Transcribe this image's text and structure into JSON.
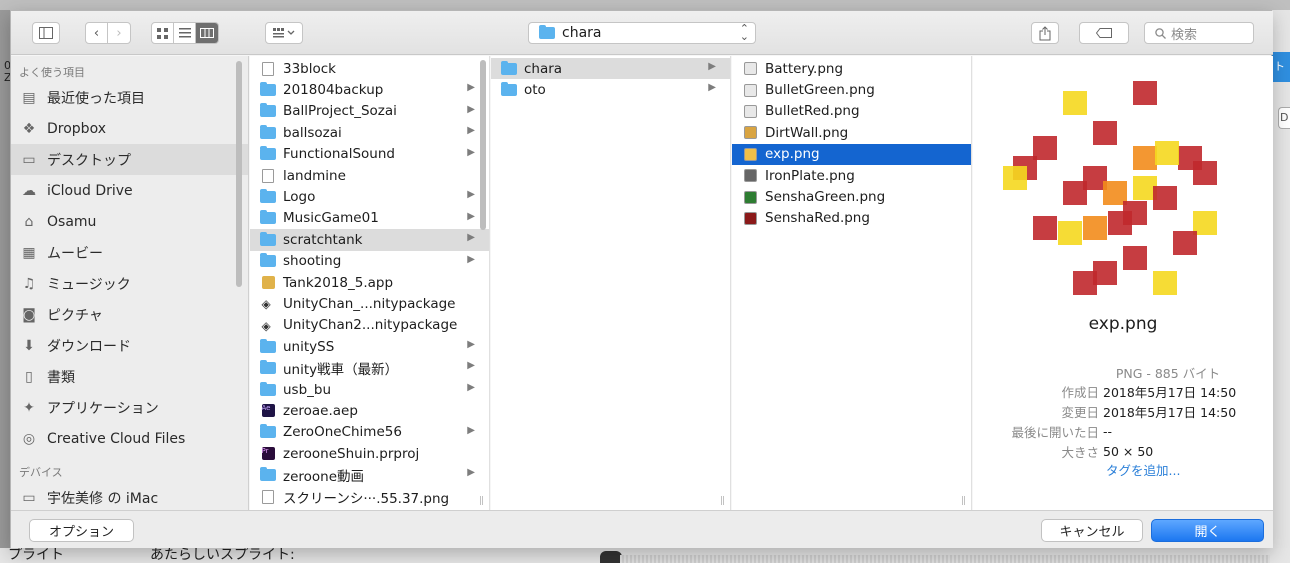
{
  "background": {
    "left_label": "0\nZ",
    "right_strip_label": "ト",
    "right_button_label": "D",
    "bottom_left_text": "プライト",
    "bottom_mid_text": "あたらしいスプライト: "
  },
  "toolbar": {
    "path_popup_label": "chara",
    "search_placeholder": "検索",
    "view_modes": [
      "icon",
      "list",
      "column"
    ],
    "active_view": "column"
  },
  "sidebar": {
    "favorites_heading": "よく使う項目",
    "items": [
      {
        "label": "最近使った項目",
        "icon": "recent-icon"
      },
      {
        "label": "Dropbox",
        "icon": "dropbox-icon"
      },
      {
        "label": "デスクトップ",
        "icon": "desktop-icon",
        "selected": true
      },
      {
        "label": "iCloud Drive",
        "icon": "cloud-icon"
      },
      {
        "label": "Osamu",
        "icon": "home-icon"
      },
      {
        "label": "ムービー",
        "icon": "movie-icon"
      },
      {
        "label": "ミュージック",
        "icon": "music-icon"
      },
      {
        "label": "ピクチャ",
        "icon": "camera-icon"
      },
      {
        "label": "ダウンロード",
        "icon": "download-icon"
      },
      {
        "label": "書類",
        "icon": "document-icon"
      },
      {
        "label": "アプリケーション",
        "icon": "applications-icon"
      },
      {
        "label": "Creative Cloud Files",
        "icon": "creative-cloud-icon"
      }
    ],
    "devices_heading": "デバイス",
    "devices": [
      {
        "label": "宇佐美修 の iMac",
        "icon": "imac-icon"
      }
    ]
  },
  "column1": {
    "items": [
      {
        "label": "33block",
        "type": "doc"
      },
      {
        "label": "201804backup",
        "type": "folder",
        "chevron": true
      },
      {
        "label": "BallProject_Sozai",
        "type": "folder",
        "chevron": true
      },
      {
        "label": "ballsozai",
        "type": "folder",
        "chevron": true
      },
      {
        "label": "FunctionalSound",
        "type": "folder",
        "chevron": true
      },
      {
        "label": "landmine",
        "type": "doc"
      },
      {
        "label": "Logo",
        "type": "folder",
        "chevron": true
      },
      {
        "label": "MusicGame01",
        "type": "folder",
        "chevron": true
      },
      {
        "label": "scratchtank",
        "type": "folder",
        "chevron": true,
        "state": "grey"
      },
      {
        "label": "shooting",
        "type": "folder",
        "chevron": true
      },
      {
        "label": "Tank2018_5.app",
        "type": "app"
      },
      {
        "label": "UnityChan_...nitypackage",
        "type": "unity"
      },
      {
        "label": "UnityChan2...nitypackage",
        "type": "unity"
      },
      {
        "label": "unitySS",
        "type": "folder",
        "chevron": true
      },
      {
        "label": "unity戦車（最新）",
        "type": "folder",
        "chevron": true
      },
      {
        "label": "usb_bu",
        "type": "folder",
        "chevron": true
      },
      {
        "label": "zeroae.aep",
        "type": "ae"
      },
      {
        "label": "ZeroOneChime56",
        "type": "folder",
        "chevron": true
      },
      {
        "label": "zerooneShuin.prproj",
        "type": "pr"
      },
      {
        "label": "zeroone動画",
        "type": "folder",
        "chevron": true
      },
      {
        "label": "スクリーンシ···.55.37.png",
        "type": "screenshot"
      }
    ]
  },
  "column2": {
    "items": [
      {
        "label": "chara",
        "type": "folder",
        "chevron": true,
        "state": "grey"
      },
      {
        "label": "oto",
        "type": "folder",
        "chevron": true
      }
    ]
  },
  "column3": {
    "items": [
      {
        "label": "Battery.png",
        "thumb": "#e8e8e8"
      },
      {
        "label": "BulletGreen.png",
        "thumb": "#e8e8e8"
      },
      {
        "label": "BulletRed.png",
        "thumb": "#e8e8e8"
      },
      {
        "label": "DirtWall.png",
        "thumb": "#d9a441"
      },
      {
        "label": "exp.png",
        "thumb": "#f0c04a",
        "state": "blue"
      },
      {
        "label": "IronPlate.png",
        "thumb": "#666666"
      },
      {
        "label": "SenshaGreen.png",
        "thumb": "#2e7d32"
      },
      {
        "label": "SenshaRed.png",
        "thumb": "#8b1a1a"
      }
    ]
  },
  "preview": {
    "file_name": "exp.png",
    "kind": "PNG - 885 バイト",
    "meta": [
      {
        "key": "作成日",
        "value": "2018年5月17日 14:50"
      },
      {
        "key": "変更日",
        "value": "2018年5月17日 14:50"
      },
      {
        "key": "最後に開いた日",
        "value": "--"
      },
      {
        "key": "大きさ",
        "value": "50 × 50"
      }
    ],
    "add_tag": "タグを追加..."
  },
  "bottom": {
    "options_label": "オプション",
    "cancel_label": "キャンセル",
    "open_label": "開く"
  },
  "colors": {
    "accent": "#1c77f0",
    "selection": "#1465d0",
    "folder": "#5bb3ee",
    "sprite_red": "#c0282c",
    "sprite_yellow": "#f5d81f",
    "sprite_orange": "#f28c1c"
  }
}
